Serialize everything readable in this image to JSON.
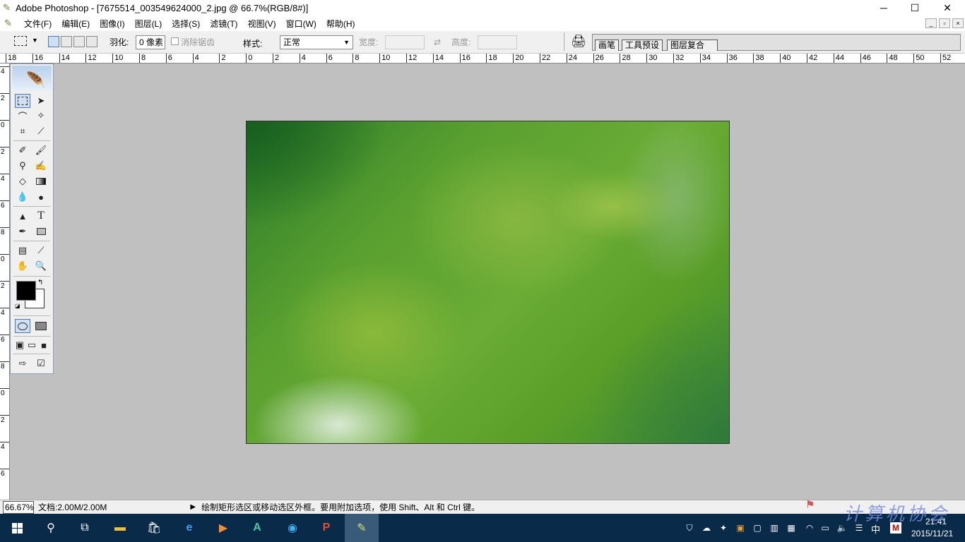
{
  "window": {
    "title": "Adobe Photoshop - [7675514_003549624000_2.jpg @ 66.7%(RGB/8#)]"
  },
  "window_buttons": {
    "minimize": "─",
    "maximize": "☐",
    "close": "✕"
  },
  "doc_buttons": {
    "minimize": "_",
    "restore": "▫",
    "close": "×"
  },
  "menu": [
    "文件(F)",
    "编辑(E)",
    "图像(I)",
    "图层(L)",
    "选择(S)",
    "滤镜(T)",
    "视图(V)",
    "窗口(W)",
    "帮助(H)"
  ],
  "options": {
    "feather_label": "羽化:",
    "feather_value": "0 像素",
    "antialias_label": "消除锯齿",
    "style_label": "样式:",
    "style_value": "正常",
    "width_label": "宽度:",
    "height_label": "高度:"
  },
  "palette_well": {
    "tabs": [
      "画笔",
      "工具预设",
      "图层复合"
    ]
  },
  "ruler": {
    "h_ticks": [
      "18",
      "16",
      "14",
      "12",
      "10",
      "8",
      "6",
      "4",
      "2",
      "0",
      "2",
      "4",
      "6",
      "8",
      "10",
      "12",
      "14",
      "16",
      "18",
      "20",
      "22",
      "24",
      "26",
      "28",
      "30",
      "32",
      "34",
      "36",
      "38",
      "40",
      "42",
      "44",
      "46",
      "48",
      "50",
      "52"
    ],
    "v_ticks": [
      "4",
      "2",
      "0",
      "2",
      "4",
      "6",
      "8",
      "0",
      "2",
      "4",
      "6",
      "8",
      "0",
      "2",
      "4",
      "6"
    ]
  },
  "status": {
    "zoom": "66.67%",
    "doc": "文档:2.00M/2.00M",
    "hint": "绘制矩形选区或移动选区外框。要用附加选项，使用 Shift、Alt 和 Ctrl 键。"
  },
  "taskbar": {
    "time": "21:41",
    "date": "2015/11/21",
    "ime": "中",
    "ime_key": "M",
    "watermark": "计算机协会"
  },
  "colors": {
    "accent": "#0a2a4a",
    "canvas_bg": "#c0c0c0"
  }
}
